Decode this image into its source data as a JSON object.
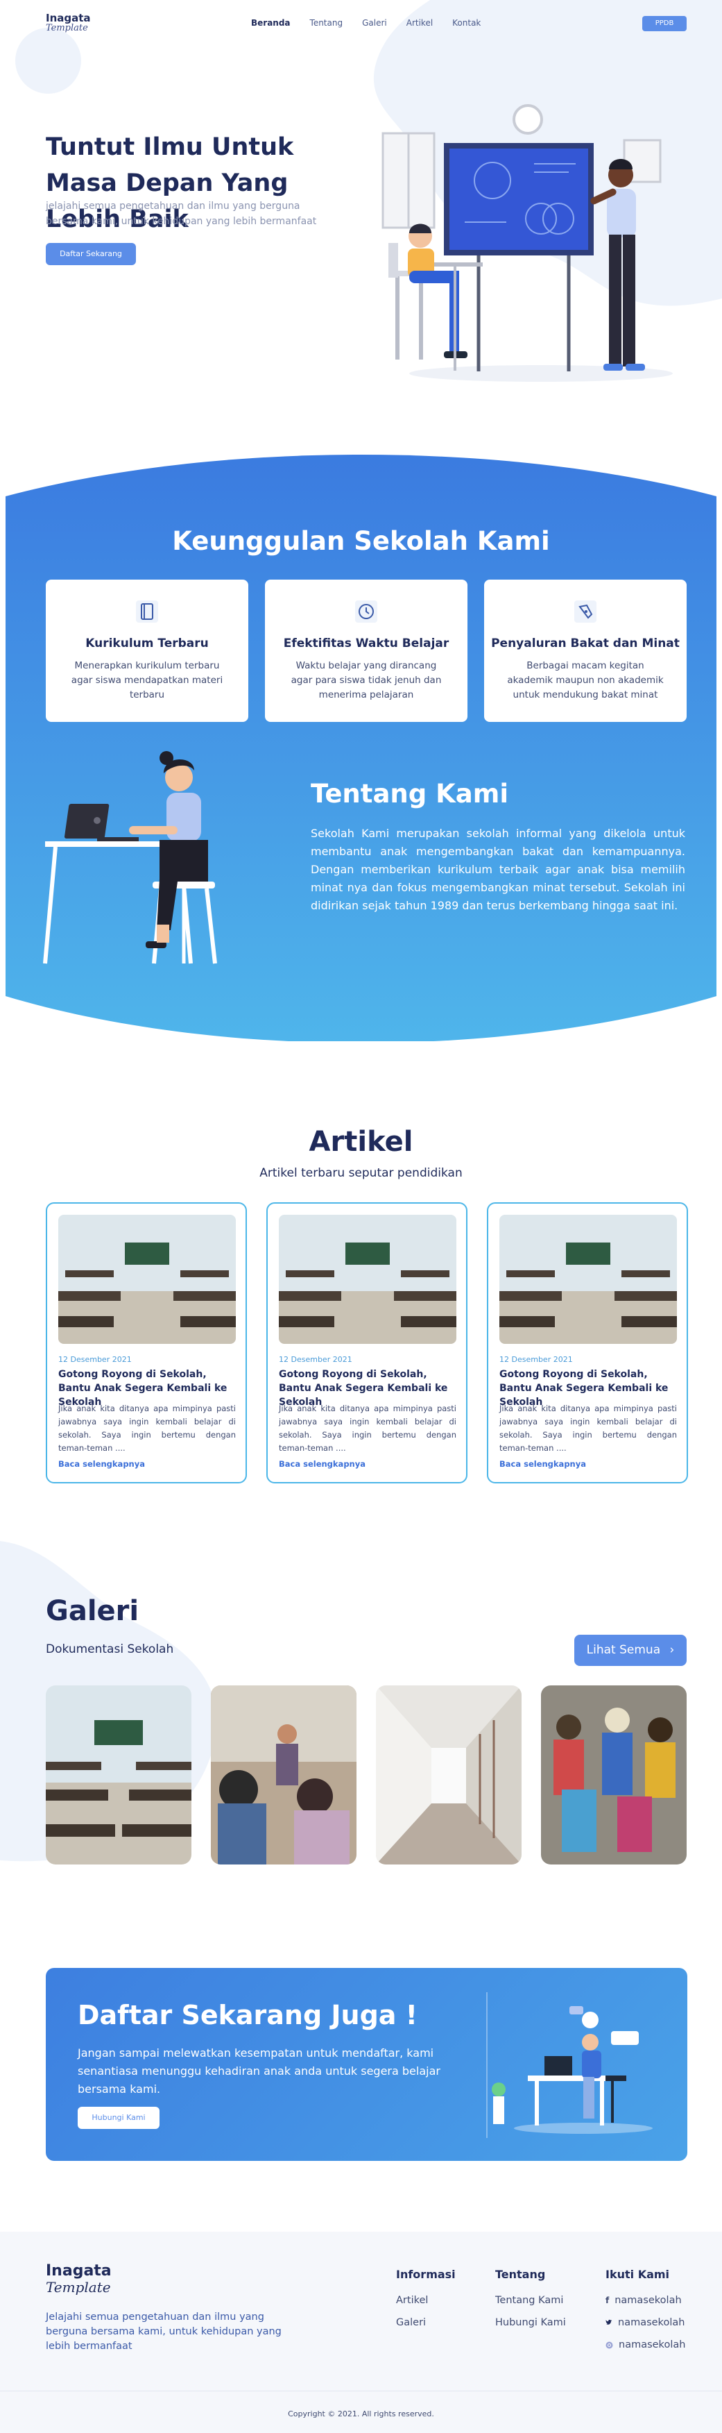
{
  "nav": {
    "logo_line1": "Inagata",
    "logo_line2": "Template",
    "items": [
      "Beranda",
      "Tentang",
      "Galeri",
      "Artikel",
      "Kontak"
    ],
    "cta": "PPDB"
  },
  "hero": {
    "title": "Tuntut Ilmu Untuk Masa Depan Yang Lebih Baik",
    "subtitle": "jelajahi semua pengetahuan dan ilmu yang berguna bersama kami, untuk kehidupan yang lebih bermanfaat",
    "button": "Daftar Sekarang"
  },
  "features": {
    "title": "Keunggulan Sekolah Kami",
    "items": [
      {
        "icon": "book-icon",
        "title": "Kurikulum Terbaru",
        "desc": "Menerapkan kurikulum terbaru agar siswa mendapatkan materi terbaru"
      },
      {
        "icon": "clock-icon",
        "title": "Efektifitas Waktu Belajar",
        "desc": "Waktu belajar yang dirancang agar para siswa tidak jenuh dan menerima pelajaran"
      },
      {
        "icon": "pen-icon",
        "title": "Penyaluran Bakat dan Minat",
        "desc": "Berbagai macam kegitan akademik maupun non akademik untuk mendukung bakat minat"
      }
    ]
  },
  "about": {
    "title": "Tentang Kami",
    "text": "Sekolah Kami merupakan sekolah informal yang dikelola untuk membantu anak mengembangkan bakat dan kemampuannya. Dengan memberikan kurikulum terbaik agar anak bisa memilih minat nya dan fokus mengembangkan minat tersebut. Sekolah ini didirikan sejak tahun 1989 dan terus berkembang hingga saat ini."
  },
  "articles": {
    "title": "Artikel",
    "subtitle": "Artikel terbaru seputar pendidikan",
    "items": [
      {
        "date": "12 Desember 2021",
        "title": "Gotong Royong di Sekolah, Bantu Anak Segera Kembali ke Sekolah",
        "excerpt": "Jika anak kita ditanya apa mimpinya pasti jawabnya saya ingin kembali belajar di sekolah. Saya ingin bertemu dengan teman-teman ....",
        "link": "Baca selengkapnya"
      },
      {
        "date": "12 Desember 2021",
        "title": "Gotong Royong di Sekolah, Bantu Anak Segera Kembali ke Sekolah",
        "excerpt": "Jika anak kita ditanya apa mimpinya pasti jawabnya saya ingin kembali belajar di sekolah. Saya ingin bertemu dengan teman-teman ....",
        "link": "Baca selengkapnya"
      },
      {
        "date": "12 Desember 2021",
        "title": "Gotong Royong di Sekolah, Bantu Anak Segera Kembali ke Sekolah",
        "excerpt": "Jika anak kita ditanya apa mimpinya pasti jawabnya saya ingin kembali belajar di sekolah. Saya ingin bertemu dengan teman-teman ....",
        "link": "Baca selengkapnya"
      }
    ]
  },
  "gallery": {
    "title": "Galeri",
    "subtitle": "Dokumentasi Sekolah",
    "button": "Lihat Semua"
  },
  "cta": {
    "title": "Daftar Sekarang Juga !",
    "text": "Jangan sampai melewatkan kesempatan untuk mendaftar, kami senantiasa menunggu kehadiran anak anda untuk segera belajar bersama kami.",
    "button": "Hubungi Kami"
  },
  "footer": {
    "logo_line1": "Inagata",
    "logo_line2": "Template",
    "desc": "Jelajahi semua pengetahuan dan ilmu yang berguna bersama kami, untuk kehidupan yang lebih bermanfaat",
    "col1": {
      "title": "Informasi",
      "items": [
        "Artikel",
        "Galeri"
      ]
    },
    "col2": {
      "title": "Tentang",
      "items": [
        "Tentang Kami",
        "Hubungi Kami"
      ]
    },
    "col3": {
      "title": "Ikuti Kami",
      "items": [
        {
          "icon": "facebook-icon",
          "label": "namasekolah"
        },
        {
          "icon": "twitter-icon",
          "label": "namasekolah"
        },
        {
          "icon": "instagram-icon",
          "label": "namasekolah"
        }
      ]
    },
    "copyright": "Copyright © 2021. All rights reserved."
  },
  "colors": {
    "primary": "#5b8de8",
    "navy": "#1f2a5a",
    "blue_top": "#3d7fe0",
    "blue_bottom": "#4fb3ea"
  }
}
